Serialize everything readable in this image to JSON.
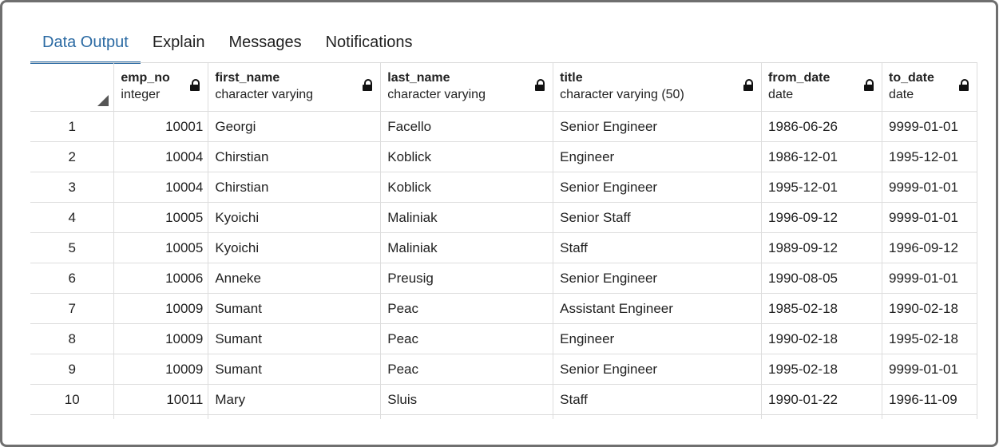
{
  "tabs": [
    "Data Output",
    "Explain",
    "Messages",
    "Notifications"
  ],
  "columns": [
    {
      "name": "emp_no",
      "type": "integer"
    },
    {
      "name": "first_name",
      "type": "character varying"
    },
    {
      "name": "last_name",
      "type": "character varying"
    },
    {
      "name": "title",
      "type": "character varying (50)"
    },
    {
      "name": "from_date",
      "type": "date"
    },
    {
      "name": "to_date",
      "type": "date"
    }
  ],
  "rows": [
    [
      "1",
      "10001",
      "Georgi",
      "Facello",
      "Senior Engineer",
      "1986-06-26",
      "9999-01-01"
    ],
    [
      "2",
      "10004",
      "Chirstian",
      "Koblick",
      "Engineer",
      "1986-12-01",
      "1995-12-01"
    ],
    [
      "3",
      "10004",
      "Chirstian",
      "Koblick",
      "Senior Engineer",
      "1995-12-01",
      "9999-01-01"
    ],
    [
      "4",
      "10005",
      "Kyoichi",
      "Maliniak",
      "Senior Staff",
      "1996-09-12",
      "9999-01-01"
    ],
    [
      "5",
      "10005",
      "Kyoichi",
      "Maliniak",
      "Staff",
      "1989-09-12",
      "1996-09-12"
    ],
    [
      "6",
      "10006",
      "Anneke",
      "Preusig",
      "Senior Engineer",
      "1990-08-05",
      "9999-01-01"
    ],
    [
      "7",
      "10009",
      "Sumant",
      "Peac",
      "Assistant Engineer",
      "1985-02-18",
      "1990-02-18"
    ],
    [
      "8",
      "10009",
      "Sumant",
      "Peac",
      "Engineer",
      "1990-02-18",
      "1995-02-18"
    ],
    [
      "9",
      "10009",
      "Sumant",
      "Peac",
      "Senior Engineer",
      "1995-02-18",
      "9999-01-01"
    ],
    [
      "10",
      "10011",
      "Mary",
      "Sluis",
      "Staff",
      "1990-01-22",
      "1996-11-09"
    ]
  ],
  "colors": {
    "accent": "#2b6aa3",
    "grid_line": "#dddddd",
    "frame": "#6f6f6f"
  },
  "icons": {
    "column_lock": "lock-icon",
    "select_all": "corner-triangle-icon"
  }
}
